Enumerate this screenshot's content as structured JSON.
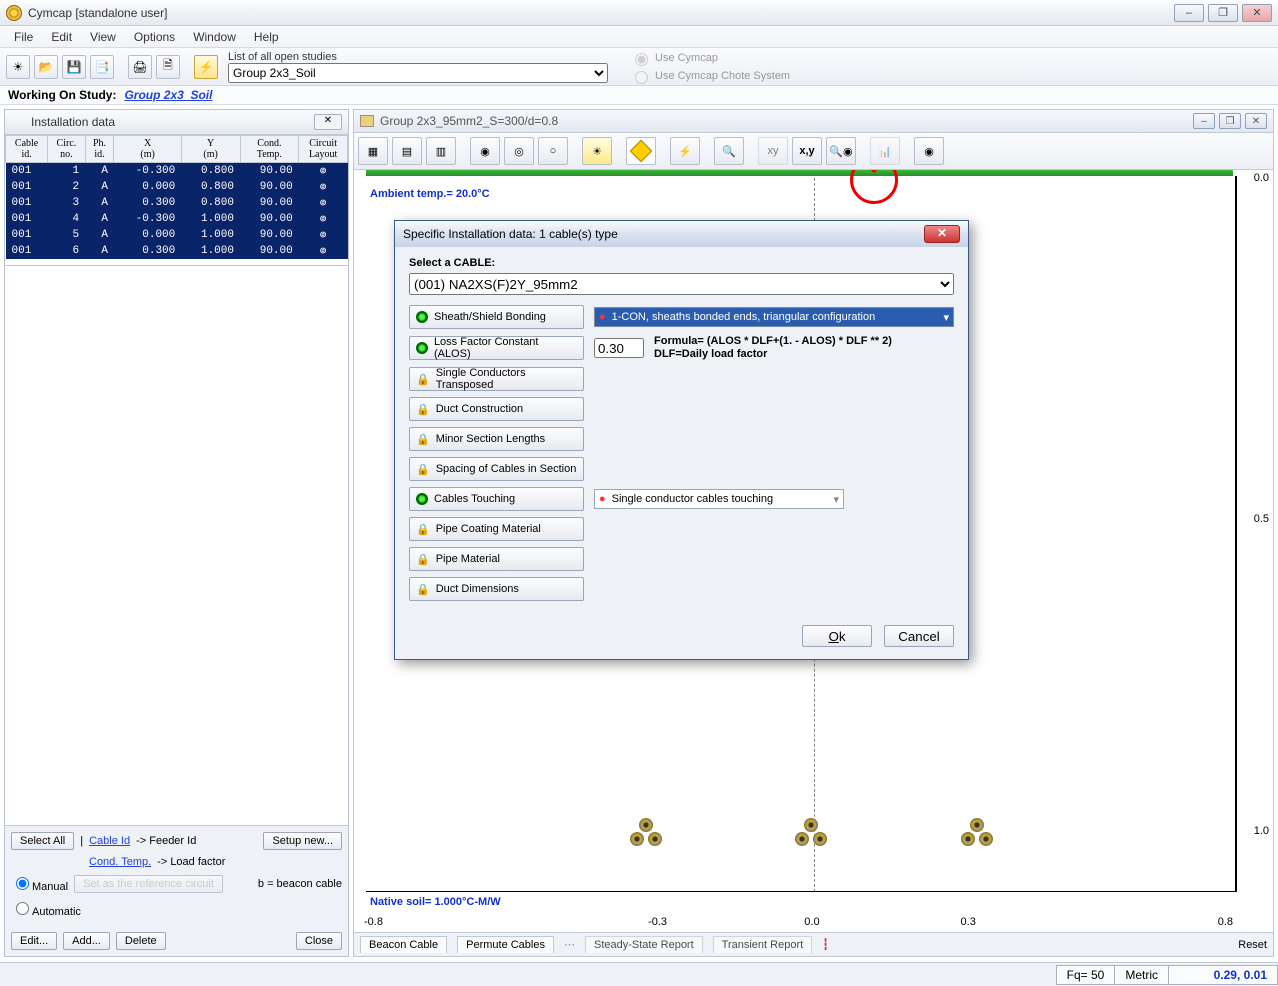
{
  "window": {
    "title": "Cymcap [standalone user]",
    "minimize": "–",
    "maximize": "❐",
    "close": "✕"
  },
  "menu": [
    "File",
    "Edit",
    "View",
    "Options",
    "Window",
    "Help"
  ],
  "toolbar1": {
    "list_label": "List of all open studies",
    "selected_study": "Group 2x3_Soil",
    "radio1": "Use Cymcap",
    "radio2": "Use Cymcap Chote System"
  },
  "working": {
    "label": "Working On Study:",
    "link": "Group 2x3_Soil"
  },
  "left": {
    "title": "Installation data",
    "columns": [
      "Cable\nid.",
      "Circ.\nno.",
      "Ph.\nid.",
      "X\n(m)",
      "Y\n(m)",
      "Cond.\nTemp.",
      "Circuit\nLayout"
    ],
    "rows": [
      [
        "001",
        "1",
        "A",
        "-0.300",
        "0.800",
        "90.00",
        "⊚"
      ],
      [
        "001",
        "2",
        "A",
        "0.000",
        "0.800",
        "90.00",
        "⊚"
      ],
      [
        "001",
        "3",
        "A",
        "0.300",
        "0.800",
        "90.00",
        "⊚"
      ],
      [
        "001",
        "4",
        "A",
        "-0.300",
        "1.000",
        "90.00",
        "⊚"
      ],
      [
        "001",
        "5",
        "A",
        "0.000",
        "1.000",
        "90.00",
        "⊚"
      ],
      [
        "001",
        "6",
        "A",
        "0.300",
        "1.000",
        "90.00",
        "⊚"
      ]
    ],
    "select_all": "Select All",
    "cable_id": "Cable Id",
    "feeder_id": "-> Feeder Id",
    "cond_temp": "Cond. Temp.",
    "load_factor": "-> Load factor",
    "setup_new": "Setup new...",
    "manual": "Manual",
    "auto": "Automatic",
    "set_ref": "Set as the reference circuit",
    "beacon_note": "b = beacon cable",
    "edit": "Edit...",
    "add": "Add...",
    "delete": "Delete",
    "close": "Close"
  },
  "doc": {
    "title": "Group 2x3_95mm2_S=300/d=0.8",
    "ambient": "Ambient temp.= 20.0°C",
    "native": "Native soil= 1.000°C-M/W",
    "axis_y": [
      "0.0",
      "0.5",
      "1.0"
    ],
    "axis_x": [
      "-0.8",
      "-0.3",
      "0.0",
      "0.3",
      "0.8"
    ],
    "tabs": [
      "Beacon Cable",
      "Permute Cables",
      "Steady-State Report",
      "Transient Report"
    ],
    "reset": "Reset"
  },
  "dialog": {
    "title": "Specific Installation data: 1 cable(s) type",
    "select_label": "Select a CABLE:",
    "cable": "(001) NA2XS(F)2Y_95mm2",
    "sheath_btn": "Sheath/Shield Bonding",
    "sheath_val": "1-CON, sheaths bonded ends, triangular configuration",
    "alos_btn": "Loss Factor Constant (ALOS)",
    "alos_val": "0.30",
    "formula1": "Formula= (ALOS * DLF+(1. - ALOS) * DLF ** 2)",
    "formula2": "DLF=Daily load factor",
    "sct": "Single Conductors Transposed",
    "duct": "Duct Construction",
    "minor": "Minor Section Lengths",
    "spacing": "Spacing of Cables in Section",
    "touching": "Cables Touching",
    "touching_val": "Single conductor cables touching",
    "pcm": "Pipe Coating Material",
    "pm": "Pipe Material",
    "dd": "Duct Dimensions",
    "ok": "Ok",
    "cancel": "Cancel"
  },
  "status": {
    "fq": "Fq= 50",
    "metric": "Metric",
    "coords": "0.29, 0.01"
  }
}
